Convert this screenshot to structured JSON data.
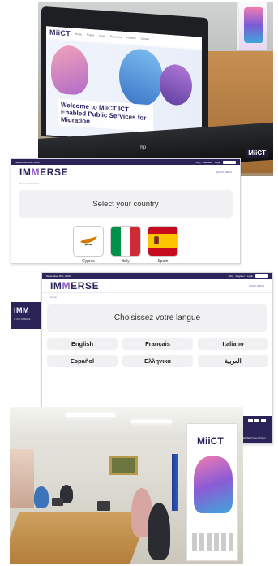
{
  "laptop_photo": {
    "site_logo": "MiiCT",
    "nav_links": [
      "Home",
      "Project",
      "News",
      "Resources",
      "Partners",
      "Contact"
    ],
    "hero_text": "Welcome to MiiCT ICT Enabled Public Services for Migration",
    "device_brand": "hp",
    "corner_logo": "MiiCT"
  },
  "country_panel": {
    "date": "September 16th, 2020",
    "top_links": [
      "FAQ",
      "Register",
      "Login"
    ],
    "language_select": "English",
    "brand_prefix": "IM",
    "brand_accent": "M",
    "brand_suffix": "ERSE",
    "quick_menu": "QUICK MENU",
    "breadcrumb": "Home > Countries",
    "title": "Select your country",
    "countries": [
      {
        "name": "Cyprus"
      },
      {
        "name": "Italy"
      },
      {
        "name": "Spain"
      }
    ],
    "footer_logo": "IMM",
    "footer_small": "© 2020 IMMERSE"
  },
  "language_panel": {
    "date": "September 16th, 2020",
    "top_links": [
      "FAQ",
      "Register",
      "Login"
    ],
    "language_select": "English",
    "brand_prefix": "IM",
    "brand_accent": "M",
    "brand_suffix": "ERSE",
    "quick_menu": "QUICK MENU",
    "breadcrumb": "Home",
    "title": "Choisissez votre langue",
    "languages": [
      "English",
      "Français",
      "Italiano",
      "Español",
      "Ελληνικά",
      "العربية"
    ],
    "footer_text": "IMMERSE Privacy Policy"
  },
  "office_photo": {
    "rollup_logo": "MiiCT"
  },
  "colors": {
    "brand_dark": "#2a2458",
    "brand_accent": "#8c58c9"
  }
}
